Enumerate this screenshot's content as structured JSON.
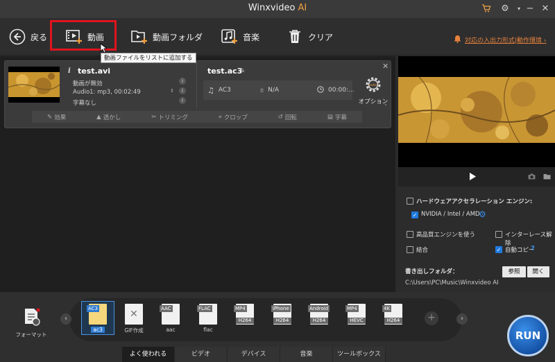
{
  "title_bar": {
    "app_name": "Winxvideo",
    "ai_label": "AI"
  },
  "toolbar": {
    "back_label": "戻る",
    "video_label": "動画",
    "video_folder_label": "動画フォルダ",
    "music_label": "音楽",
    "clear_label": "クリア",
    "notice_text": "対応の入出力形式|動作環境 ›",
    "tooltip": "動画ファイルをリストに追加する"
  },
  "file_item": {
    "source_name": "test.avi",
    "video_status": "動画が無効",
    "audio_info": "Audio1: mp3, 00:02:49",
    "subtitle_info": "字幕なし",
    "output_name": "test.ac3",
    "output_codec": "AC3",
    "output_resolution": "N/A",
    "output_duration": "00:00:...",
    "option_label": "オプション",
    "edit_tools": [
      "効果",
      "透かし",
      "トリミング",
      "クロップ",
      "回転",
      "字幕"
    ]
  },
  "settings": {
    "hw_accel_label": "ハードウェアアクセラレーション エンジン:",
    "gpu_label": "NVIDIA / Intel / AMD",
    "hq_engine_label": "高品質エンジンを使う",
    "deinterlace_label": "インターレース解除",
    "merge_label": "結合",
    "auto_copy_label": "自動コピー",
    "help_mark": "?",
    "output_folder_label": "書き出しフォルダ：",
    "browse_label": "参照",
    "open_label": "開く",
    "output_path": "C:\\Users\\PC\\Music\\Winxvideo AI"
  },
  "formats": {
    "tool_label": "フォーマット",
    "items": [
      {
        "tag": "AC3",
        "codec": "",
        "label": "ac3"
      },
      {
        "tag": "",
        "codec": "",
        "label": "GIF作成"
      },
      {
        "tag": "AAC",
        "codec": "",
        "label": "aac"
      },
      {
        "tag": "FLAC",
        "codec": "",
        "label": "flac"
      },
      {
        "tag": "MP4",
        "codec": "H264",
        "label": ""
      },
      {
        "tag": "iPhone",
        "codec": "H264",
        "label": ""
      },
      {
        "tag": "Android",
        "codec": "H264",
        "label": ""
      },
      {
        "tag": "MP4",
        "codec": "HEVC",
        "label": ""
      },
      {
        "tag": "4K",
        "codec": "H264",
        "label": ""
      }
    ]
  },
  "tabs": [
    "よく使われる",
    "ビデオ",
    "デバイス",
    "音楽",
    "ツールボックス"
  ],
  "run_label": "RUN",
  "colors": {
    "accent": "#e8823a",
    "highlight": "#e1141d",
    "run": "#1f6fd0"
  }
}
